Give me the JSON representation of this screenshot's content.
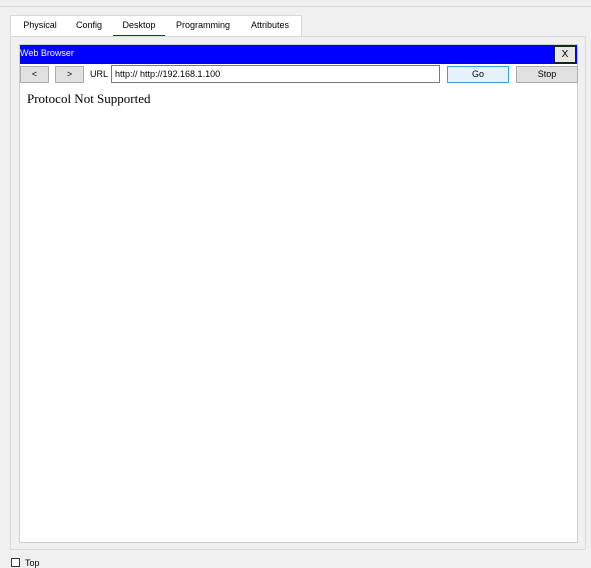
{
  "tabs": [
    {
      "label": "Physical"
    },
    {
      "label": "Config"
    },
    {
      "label": "Desktop",
      "active": true
    },
    {
      "label": "Programming"
    },
    {
      "label": "Attributes"
    }
  ],
  "browser": {
    "title": "Web Browser",
    "close_label": "X",
    "back_label": "<",
    "forward_label": ">",
    "url_label": "URL",
    "url_value": "http:// http://192.168.1.100",
    "go_label": "Go",
    "stop_label": "Stop",
    "message": "Protocol Not Supported"
  },
  "footer": {
    "checkbox_label": "Top"
  },
  "colors": {
    "titlebar": "#0000ff",
    "active_tab_underline": "#1a3a63",
    "go_button_border": "#3c9fd9"
  }
}
